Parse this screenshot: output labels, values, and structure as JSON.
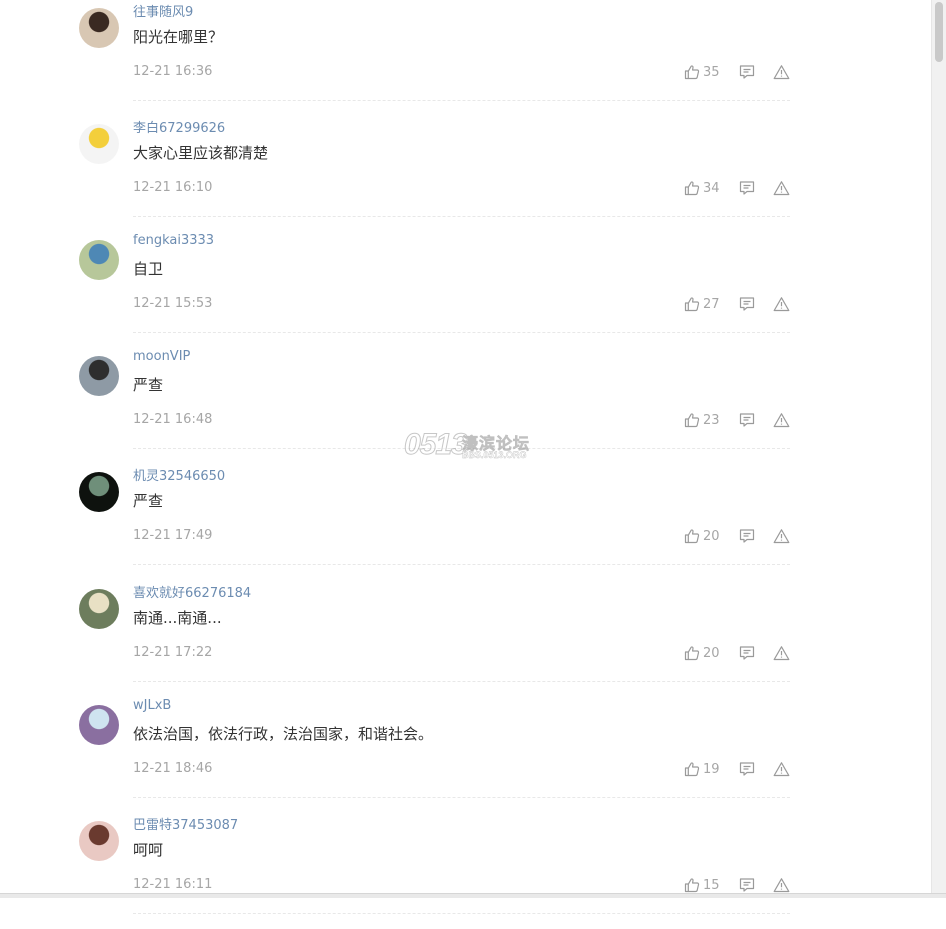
{
  "comments": [
    {
      "username": "往事随风9",
      "content": "阳光在哪里？",
      "time": "12-21 16:36",
      "likes": "35",
      "avatar_colors": [
        "#d8c7b3",
        "#3a2a22"
      ]
    },
    {
      "username": "李白67299626",
      "content": "大家心里应该都清楚",
      "time": "12-21 16:10",
      "likes": "34",
      "avatar_colors": [
        "#f4f4f4",
        "#f3cf3b"
      ]
    },
    {
      "username": "fengkai3333",
      "content": "自卫",
      "time": "12-21 15:53",
      "likes": "27",
      "avatar_colors": [
        "#b7c79a",
        "#4e88b5"
      ]
    },
    {
      "username": "moonVIP",
      "content": "严查",
      "time": "12-21 16:48",
      "likes": "23",
      "avatar_colors": [
        "#8e9aa5",
        "#2e2e2e"
      ]
    },
    {
      "username": "机灵32546650",
      "content": "严查",
      "time": "12-21 17:49",
      "likes": "20",
      "avatar_colors": [
        "#0e120e",
        "#6f8f7a"
      ]
    },
    {
      "username": "喜欢就好66276184",
      "content": "南通...南通...",
      "time": "12-21 17:22",
      "likes": "20",
      "avatar_colors": [
        "#6d7d5d",
        "#e8e0c4"
      ]
    },
    {
      "username": "wJLxB",
      "content": "依法治国，依法行政，法治国家，和谐社会。",
      "time": "12-21 18:46",
      "likes": "19",
      "avatar_colors": [
        "#8a6fa0",
        "#cfe4f0"
      ]
    },
    {
      "username": "巴雷特37453087",
      "content": "呵呵",
      "time": "12-21 16:11",
      "likes": "15",
      "avatar_colors": [
        "#e9c9c3",
        "#6a3a2f"
      ]
    }
  ],
  "watermark": {
    "number": "0513",
    "title": "濠滨论坛",
    "url": "BBS.0513.ORG"
  },
  "icons": {
    "like": "thumbs-up-icon",
    "reply": "comment-icon",
    "report": "warning-icon"
  },
  "colors": {
    "username": "#6c8cb1",
    "text": "#333333",
    "muted": "#a6a6a6"
  }
}
